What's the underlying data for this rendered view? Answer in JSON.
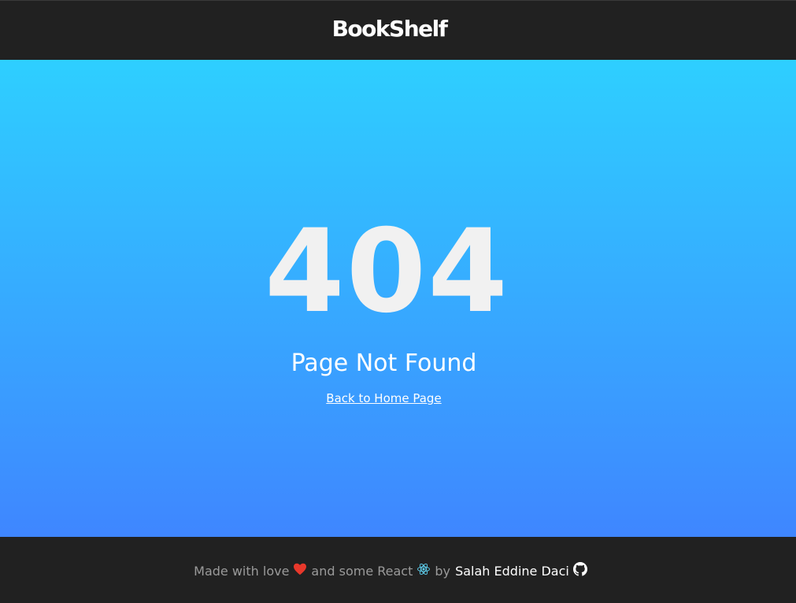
{
  "header": {
    "logo": "BookShelf"
  },
  "error": {
    "code": "404",
    "message": "Page Not Found",
    "link_label": "Back to Home Page"
  },
  "footer": {
    "made_with": "Made with love",
    "and_some": "and some React",
    "by": "by",
    "author": "Salah Eddine Daci",
    "icons": [
      "heart-icon",
      "react-icon",
      "github-icon"
    ],
    "heart_color": "#e8382b",
    "react_color": "#5fd3f3"
  },
  "colors": {
    "background_dark": "#212121",
    "gradient_top": "#2ecfff",
    "gradient_bottom": "#3f86ff",
    "code_text": "#f1f1f1"
  }
}
